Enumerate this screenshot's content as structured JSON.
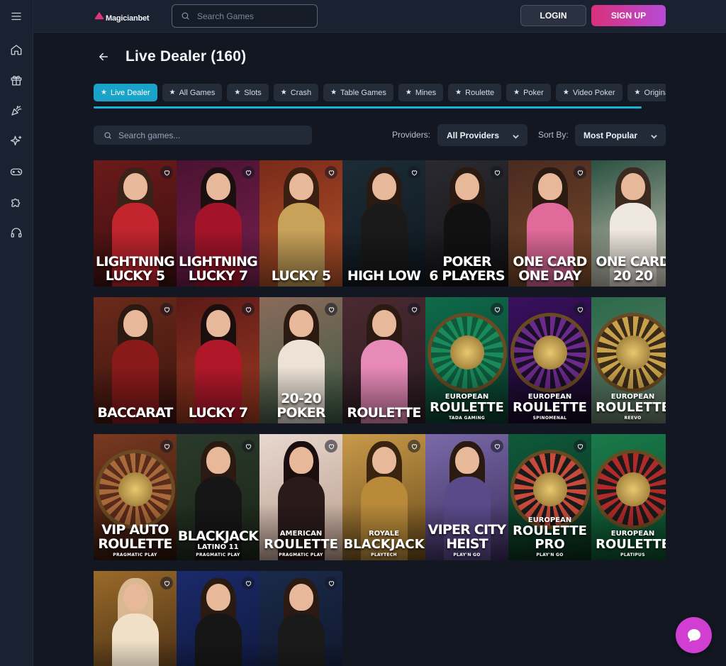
{
  "app": {
    "logo_text": "Magicianbet",
    "brand_color": "#e0377f"
  },
  "header": {
    "search_placeholder": "Search Games",
    "login_label": "LOGIN",
    "signup_label": "SIGN UP"
  },
  "sidebar": {
    "items": [
      {
        "icon": "menu-icon"
      },
      {
        "icon": "home-icon"
      },
      {
        "icon": "gift-icon"
      },
      {
        "icon": "party-popper-icon"
      },
      {
        "icon": "sparkles-icon"
      },
      {
        "icon": "gamepad-icon"
      },
      {
        "icon": "puzzle-icon"
      },
      {
        "icon": "headset-icon"
      }
    ]
  },
  "page": {
    "title": "Live Dealer (160)"
  },
  "tabs": [
    {
      "label": "Live Dealer",
      "active": true
    },
    {
      "label": "All Games"
    },
    {
      "label": "Slots"
    },
    {
      "label": "Crash"
    },
    {
      "label": "Table Games"
    },
    {
      "label": "Mines"
    },
    {
      "label": "Roulette"
    },
    {
      "label": "Poker"
    },
    {
      "label": "Video Poker"
    },
    {
      "label": "Originals"
    }
  ],
  "filters": {
    "search_placeholder": "Search games...",
    "providers_label": "Providers:",
    "providers_value": "All Providers",
    "sort_label": "Sort By:",
    "sort_value": "Most Popular"
  },
  "games": [
    {
      "line1": "LIGHTNING",
      "line2": "LUCKY 5"
    },
    {
      "line1": "LIGHTNING",
      "line2": "LUCKY 7"
    },
    {
      "line1": "",
      "line2": "LUCKY 5"
    },
    {
      "line1": "",
      "line2": "HIGH LOW"
    },
    {
      "line1": "POKER",
      "line2": "6 PLAYERS"
    },
    {
      "line1": "ONE CARD",
      "line2": "ONE DAY"
    },
    {
      "line1": "ONE CARD",
      "line2": "20 20"
    },
    {
      "line1": "",
      "line2": "BACCARAT"
    },
    {
      "line1": "",
      "line2": "LUCKY 7"
    },
    {
      "line1": "",
      "line2": "20-20 POKER"
    },
    {
      "line1": "",
      "line2": "ROULETTE"
    },
    {
      "sub": "EUROPEAN",
      "main": "ROULETTE",
      "provider": "TADA GAMING"
    },
    {
      "sub": "EUROPEAN",
      "main": "ROULETTE",
      "provider": "SPINOMENAL"
    },
    {
      "sub": "EUROPEAN",
      "main": "ROULETTE",
      "provider": "REEVO"
    },
    {
      "line1": "VIP AUTO",
      "line2": "ROULETTE",
      "provider": "PRAGMATIC PLAY"
    },
    {
      "line1": "BLACKJACK",
      "sub2": "LATINO 11",
      "provider": "PRAGMATIC PLAY"
    },
    {
      "sub": "AMERICAN",
      "main": "ROULETTE",
      "provider": "PRAGMATIC PLAY"
    },
    {
      "sub": "ROYALE",
      "main": "BLACKJACK",
      "provider": "PLAYTECH"
    },
    {
      "line1": "VIPER CITY",
      "line2": "HEIST",
      "provider": "PLAY'N GO"
    },
    {
      "sub": "EUROPEAN",
      "main": "ROULETTE",
      "main2": "PRO",
      "provider": "PLAY'N GO"
    },
    {
      "sub": "EUROPEAN",
      "main": "ROULETTE",
      "provider": "PLATIPUS"
    },
    {
      "line1": "",
      "line2": ""
    },
    {
      "line1": "",
      "line2": ""
    },
    {
      "line1": "",
      "line2": ""
    }
  ]
}
